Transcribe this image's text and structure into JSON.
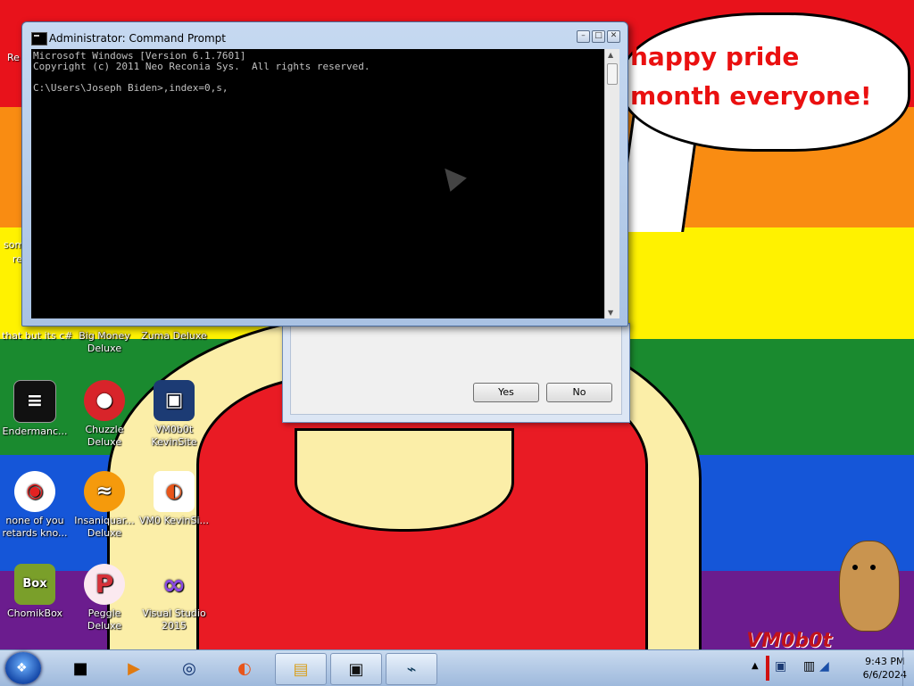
{
  "wallpaper": {
    "bubble_text": "happy pride month everyone!",
    "watermark": "VM0b0t"
  },
  "desktop_icons": [
    {
      "label": "Big Money Deluxe",
      "icon": "big-money-icon",
      "color": "#c81818",
      "glyph": ""
    },
    {
      "label": "Zuma Deluxe",
      "icon": "zuma-icon",
      "color": "#2a8f3a",
      "glyph": ""
    },
    {
      "label": "Endermanc...",
      "icon": "enderman-terminal-icon",
      "color": "#111111",
      "glyph": "≡"
    },
    {
      "label": "Chuzzle Deluxe",
      "icon": "chuzzle-icon",
      "color": "#d8242a",
      "glyph": "●"
    },
    {
      "label": "VM0b0t KevinSite",
      "icon": "vm0b0t-site-icon",
      "color": "#1c3b74",
      "glyph": "▣"
    },
    {
      "label": "none of you retards kno...",
      "icon": "red-bird-icon",
      "color": "#e42222",
      "glyph": "◉"
    },
    {
      "label": "Insaniquar... Deluxe",
      "icon": "goldfish-icon",
      "color": "#f59a0c",
      "glyph": "≈"
    },
    {
      "label": "VM0 KevinSi...",
      "icon": "firefox-file-icon",
      "color": "#4b2c8e",
      "glyph": "◐"
    },
    {
      "label": "ChomikBox",
      "icon": "chomikbox-icon",
      "color": "#7a5a20",
      "glyph": "Box"
    },
    {
      "label": "Peggle Deluxe",
      "icon": "peggle-icon",
      "color": "#d6313a",
      "glyph": "P"
    },
    {
      "label": "Visual Studio 2015",
      "icon": "visual-studio-icon",
      "color": "#6a2da8",
      "glyph": "∞"
    }
  ],
  "partial_labels": [
    "Re",
    "som",
    "re",
    "that but its c#"
  ],
  "cmd": {
    "title": "Administrator: Command Prompt",
    "console_text": "Microsoft Windows [Version 6.1.7601]\nCopyright (c) 2011 Neo Reconia Sys.  All rights reserved.\n\nC:\\Users\\Joseph Biden>,index=0,s,"
  },
  "dialog": {
    "yes_label": "Yes",
    "no_label": "No"
  },
  "taskbar": {
    "time": "9:43 PM",
    "date": "6/6/2024",
    "items": [
      {
        "icon": "black-app-icon",
        "glyph": "■"
      },
      {
        "icon": "media-player-icon",
        "glyph": "▶"
      },
      {
        "icon": "globe-icon",
        "glyph": "◎"
      },
      {
        "icon": "firefox-icon",
        "glyph": "◐"
      },
      {
        "icon": "explorer-icon",
        "glyph": "▤"
      },
      {
        "icon": "cmd-taskbar-icon",
        "glyph": "▣"
      },
      {
        "icon": "monitor-icon",
        "glyph": "⌁"
      }
    ]
  }
}
